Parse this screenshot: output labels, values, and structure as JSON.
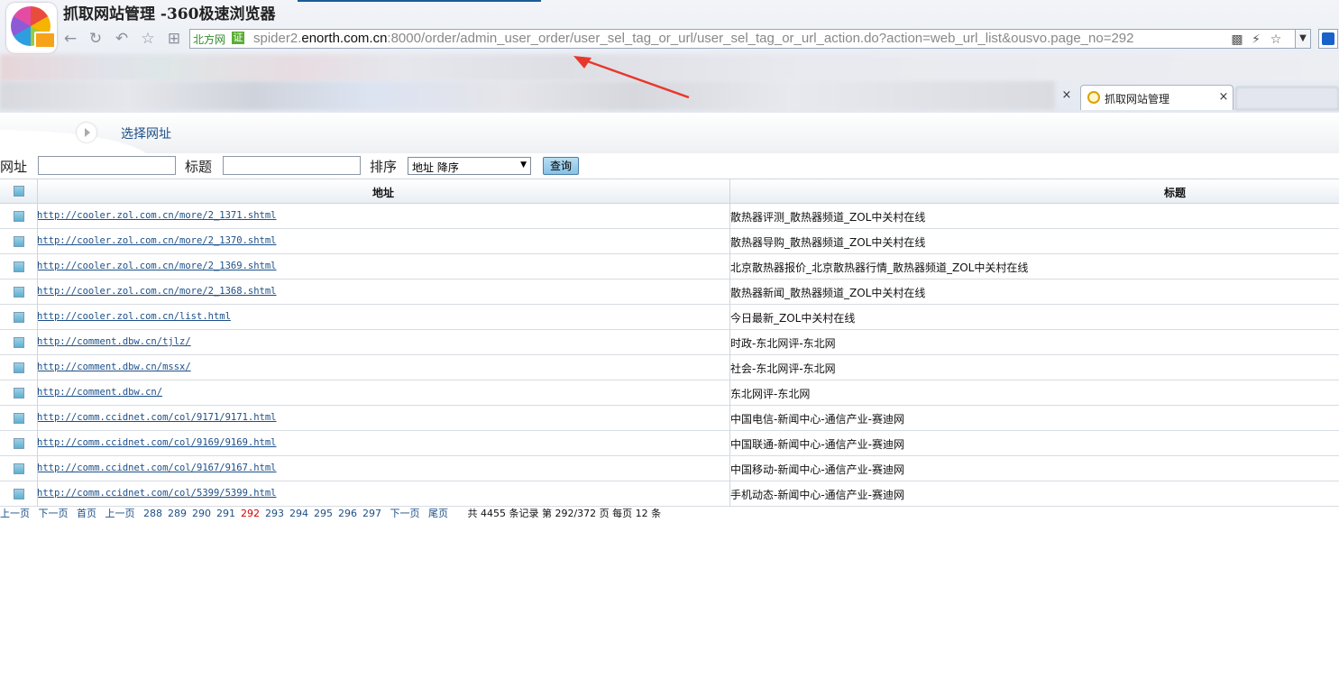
{
  "browser": {
    "window_title": "抓取网站管理 -360极速浏览器",
    "url_site_label": "北方网",
    "url_cert_label": "证",
    "url_prefix": "spider2.",
    "url_host": "enorth.com.cn",
    "url_rest": ":8000/order/admin_user_order/user_sel_tag_or_url/user_sel_tag_or_url_action.do?action=web_url_list&ousvo.page_no=292",
    "icons": [
      "back-icon",
      "refresh-icon",
      "undo-icon",
      "star-icon",
      "grid-icon",
      "qr-icon",
      "flash-icon",
      "favorite-icon",
      "dropdown-icon",
      "extension-icon"
    ],
    "active_tab_label": "抓取网站管理",
    "tab_close_glyph": "×"
  },
  "page": {
    "title": "选择网址"
  },
  "search": {
    "url_label": "网址",
    "url_value": "",
    "title_label": "标题",
    "title_value": "",
    "sort_label": "排序",
    "sort_selected": "地址 降序",
    "query_button": "查询"
  },
  "table": {
    "columns": [
      "地址",
      "标题"
    ],
    "rows": [
      {
        "url": "http://cooler.zol.com.cn/more/2_1371.shtml",
        "title": "散热器评测_散热器频道_ZOL中关村在线"
      },
      {
        "url": "http://cooler.zol.com.cn/more/2_1370.shtml",
        "title": "散热器导购_散热器频道_ZOL中关村在线"
      },
      {
        "url": "http://cooler.zol.com.cn/more/2_1369.shtml",
        "title": "北京散热器报价_北京散热器行情_散热器频道_ZOL中关村在线"
      },
      {
        "url": "http://cooler.zol.com.cn/more/2_1368.shtml",
        "title": "散热器新闻_散热器频道_ZOL中关村在线"
      },
      {
        "url": "http://cooler.zol.com.cn/list.html",
        "title": "今日最新_ZOL中关村在线"
      },
      {
        "url": "http://comment.dbw.cn/tjlz/",
        "title": "时政-东北网评-东北网"
      },
      {
        "url": "http://comment.dbw.cn/mssx/",
        "title": "社会-东北网评-东北网"
      },
      {
        "url": "http://comment.dbw.cn/",
        "title": "东北网评-东北网"
      },
      {
        "url": "http://comm.ccidnet.com/col/9171/9171.html",
        "title": "中国电信-新闻中心-通信产业-赛迪网"
      },
      {
        "url": "http://comm.ccidnet.com/col/9169/9169.html",
        "title": "中国联通-新闻中心-通信产业-赛迪网"
      },
      {
        "url": "http://comm.ccidnet.com/col/9167/9167.html",
        "title": "中国移动-新闻中心-通信产业-赛迪网"
      },
      {
        "url": "http://comm.ccidnet.com/col/5399/5399.html",
        "title": "手机动态-新闻中心-通信产业-赛迪网"
      }
    ]
  },
  "pager": {
    "prev": "上一页",
    "next": "下一页",
    "first": "首页",
    "prev2": "上一页",
    "pages": [
      "288",
      "289",
      "290",
      "291",
      "292",
      "293",
      "294",
      "295",
      "296",
      "297"
    ],
    "current_page": "292",
    "next2": "下一页",
    "last": "尾页",
    "info": "共 4455 条记录 第 292/372 页 每页 12 条"
  },
  "colors": {
    "link": "#1c4f88",
    "current_page": "#d40000",
    "arrow": "#e8382c"
  }
}
